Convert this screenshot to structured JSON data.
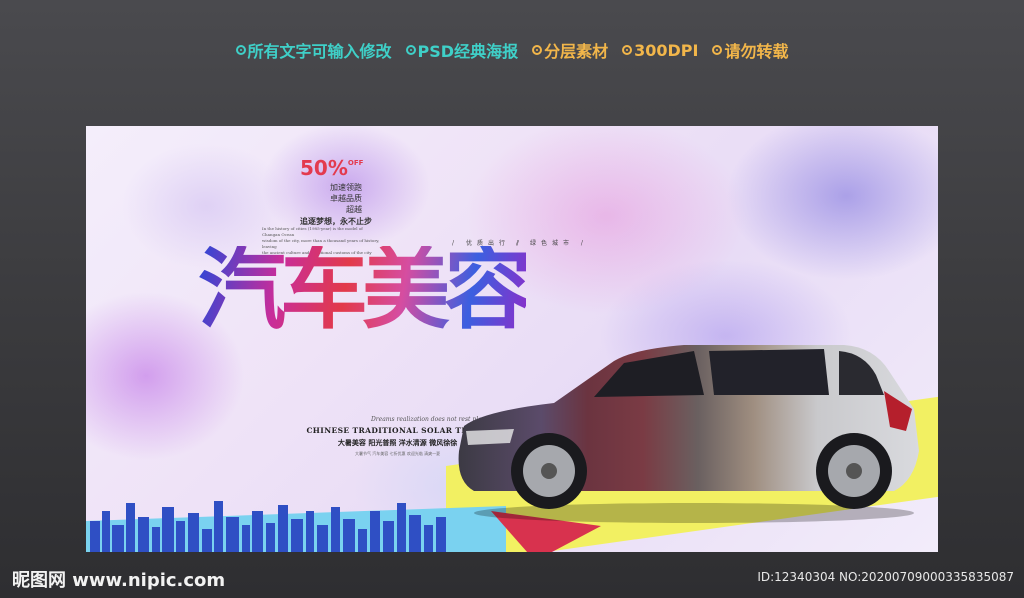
{
  "features": [
    {
      "text": "所有文字可输入修改",
      "color": "#3fd0c8"
    },
    {
      "text": "PSD经典海报",
      "color": "#3fd0c8"
    },
    {
      "text": "分层素材",
      "color": "#f2b64a"
    },
    {
      "text": "300DPI",
      "color": "#f2b64a"
    },
    {
      "text": "请勿转载",
      "color": "#f2b64a"
    }
  ],
  "poster": {
    "discount": "50%",
    "discount_suffix": "OFF",
    "tag_lines": [
      "加速领跑",
      "卓越品质",
      "超越"
    ],
    "slogan": "追逐梦想，永不止步",
    "small_text_a": "In the history of cities (1985-year) is the model of Changan Ocean",
    "small_text_b": "wisdom of the city, more than a thousand years of history, leaving",
    "small_text_c": "the ancient culture and traditional customs of the city",
    "tags_right": [
      "优",
      "质",
      "出",
      "行"
    ],
    "tags_right2": [
      "绿",
      "色",
      "城",
      "市"
    ],
    "title": "汽车美容",
    "script_line": "Dreams realization does not rest placement",
    "subtitle_en": "CHINESE TRADITIONAL SOLAR TERMS",
    "subtitle_cn": "大暑美容 阳光普照 洋水清源 微风徐徐",
    "subtitle_small": "大暑节气 汽车美容 七折优惠 欢迎光临 清爽一夏"
  },
  "watermark": {
    "site": "昵图网 www.nipic.com",
    "id": "ID:12340304 NO:20200709000335835087"
  },
  "colors": {
    "accent_teal": "#3fd0c8",
    "accent_orange": "#f2b64a",
    "discount_red": "#e33a4e"
  }
}
